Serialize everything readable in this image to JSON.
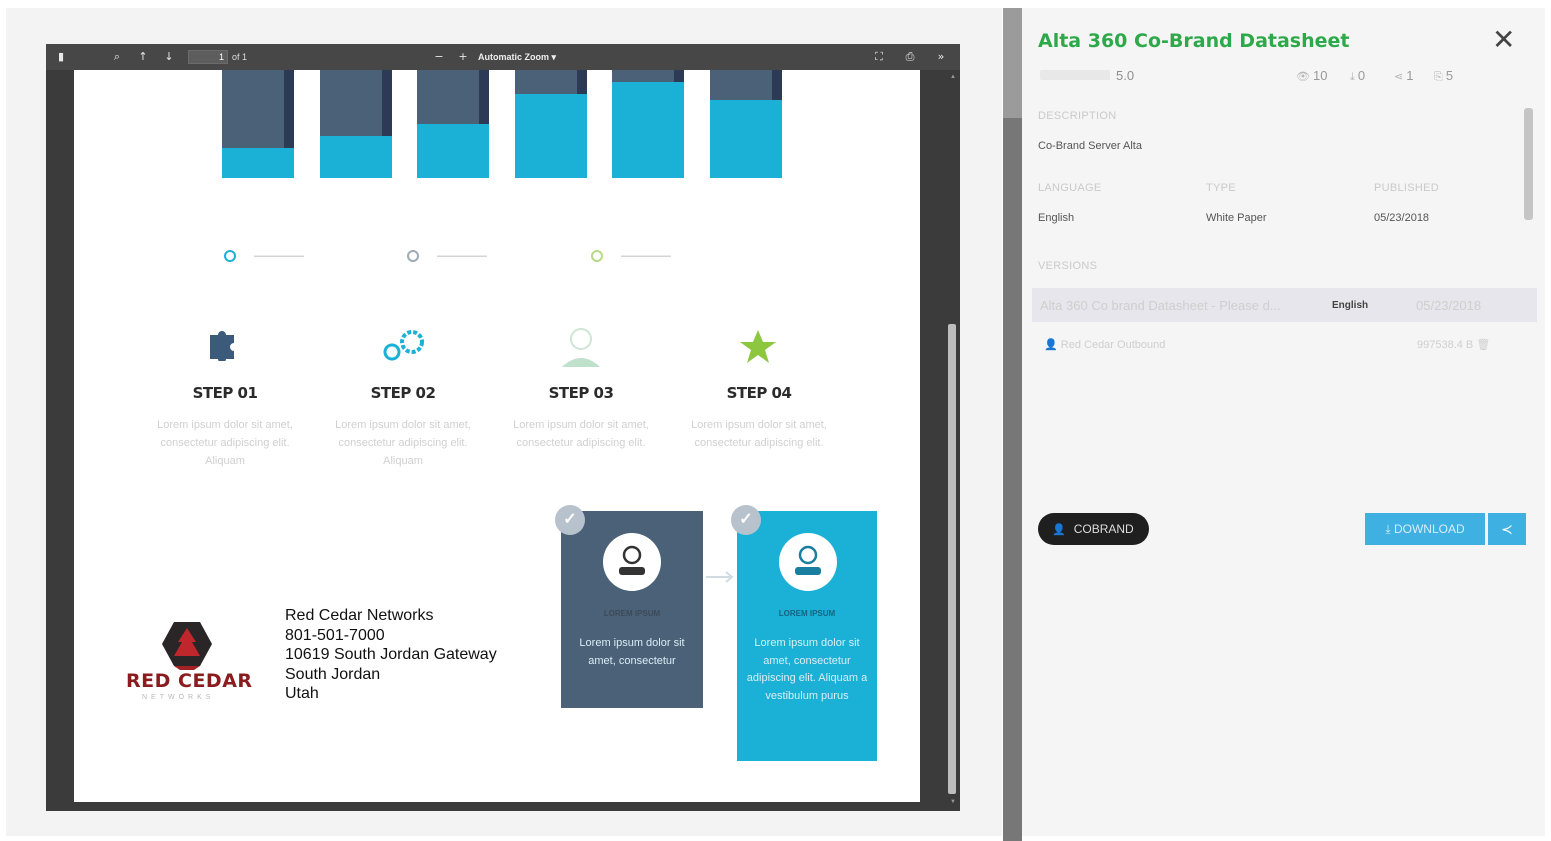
{
  "viewer": {
    "page_value": "1",
    "page_count": "of 1",
    "zoom_label": "Automatic Zoom"
  },
  "document": {
    "chart_data": {
      "type": "bar",
      "categories": [
        "",
        "",
        "",
        "",
        "",
        ""
      ],
      "series": [
        {
          "values": [
            25,
            35,
            45,
            70,
            80,
            65
          ]
        },
        {
          "values": [
            75,
            65,
            55,
            30,
            20,
            25
          ]
        },
        {
          "values": [
            0,
            0,
            0,
            0,
            0,
            10
          ]
        }
      ],
      "ylim": [
        0,
        100
      ]
    },
    "steps": [
      {
        "title": "STEP 01",
        "text": "Lorem ipsum dolor sit amet, consectetur adipiscing elit. Aliquam"
      },
      {
        "title": "STEP 02",
        "text": "Lorem ipsum dolor sit amet, consectetur adipiscing elit. Aliquam"
      },
      {
        "title": "STEP 03",
        "text": "Lorem ipsum dolor sit amet, consectetur adipiscing elit."
      },
      {
        "title": "STEP 04",
        "text": "Lorem ipsum dolor sit amet, consectetur adipiscing elit."
      }
    ],
    "cards": [
      {
        "label": "LOREM IPSUM",
        "body": "Lorem ipsum dolor sit amet, consectetur"
      },
      {
        "label": "LOREM IPSUM",
        "body": "Lorem ipsum dolor sit amet, consectetur adipiscing elit. Aliquam a vestibulum purus"
      }
    ],
    "logo": {
      "name": "RED CEDAR",
      "sub": "NETWORKS"
    },
    "contact": {
      "line1": "Red Cedar Networks",
      "line2": "801-501-7000",
      "line3": "10619 South Jordan Gateway",
      "line4": "South Jordan",
      "line5": "Utah"
    }
  },
  "panel": {
    "title": "Alta 360 Co-Brand Datasheet",
    "close_label": "✕",
    "rating": "5.0",
    "stats": {
      "views": "10",
      "downloads": "0",
      "shares": "1",
      "cobrands": "5"
    },
    "description_label": "DESCRIPTION",
    "description_value": "Co-Brand Server Alta",
    "language_label": "LANGUAGE",
    "language_value": "English",
    "type_label": "TYPE",
    "type_value": "White Paper",
    "published_label": "PUBLISHED",
    "published_value": "05/23/2018",
    "versions_label": "VERSIONS",
    "version": {
      "name": "Alta 360 Co brand Datasheet - Please d...",
      "language": "English",
      "date": "05/23/2018",
      "user": "Red Cedar Outbound",
      "size": "997538.4 B"
    },
    "cobrand_label": "COBRAND",
    "download_label": "DOWNLOAD"
  },
  "colors": {
    "accent_green": "#2ea94a",
    "accent_blue": "#3fb0e2",
    "chart_dark": "#4a6178",
    "chart_light": "#1bb0d6",
    "brand_red": "#8a1c1f"
  }
}
